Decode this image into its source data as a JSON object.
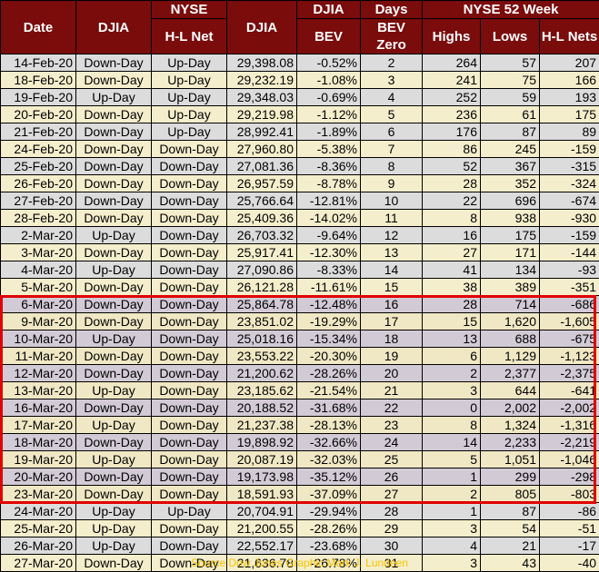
{
  "header": {
    "row1": [
      "Date",
      "DJIA",
      "NYSE",
      "DJIA",
      "DJIA",
      "Days",
      "NYSE 52 Week"
    ],
    "row2": [
      "H-L Net",
      "BEV",
      "BEV Zero",
      "Highs",
      "Lows",
      "H-L Nets"
    ]
  },
  "rows": [
    [
      "14-Feb-20",
      "Down-Day",
      "Up-Day",
      "29,398.08",
      "-0.52%",
      "2",
      "264",
      "57",
      "207"
    ],
    [
      "18-Feb-20",
      "Down-Day",
      "Up-Day",
      "29,232.19",
      "-1.08%",
      "3",
      "241",
      "75",
      "166"
    ],
    [
      "19-Feb-20",
      "Up-Day",
      "Up-Day",
      "29,348.03",
      "-0.69%",
      "4",
      "252",
      "59",
      "193"
    ],
    [
      "20-Feb-20",
      "Down-Day",
      "Up-Day",
      "29,219.98",
      "-1.12%",
      "5",
      "236",
      "61",
      "175"
    ],
    [
      "21-Feb-20",
      "Down-Day",
      "Up-Day",
      "28,992.41",
      "-1.89%",
      "6",
      "176",
      "87",
      "89"
    ],
    [
      "24-Feb-20",
      "Down-Day",
      "Down-Day",
      "27,960.80",
      "-5.38%",
      "7",
      "86",
      "245",
      "-159"
    ],
    [
      "25-Feb-20",
      "Down-Day",
      "Down-Day",
      "27,081.36",
      "-8.36%",
      "8",
      "52",
      "367",
      "-315"
    ],
    [
      "26-Feb-20",
      "Down-Day",
      "Down-Day",
      "26,957.59",
      "-8.78%",
      "9",
      "28",
      "352",
      "-324"
    ],
    [
      "27-Feb-20",
      "Down-Day",
      "Down-Day",
      "25,766.64",
      "-12.81%",
      "10",
      "22",
      "696",
      "-674"
    ],
    [
      "28-Feb-20",
      "Down-Day",
      "Down-Day",
      "25,409.36",
      "-14.02%",
      "11",
      "8",
      "938",
      "-930"
    ],
    [
      "2-Mar-20",
      "Up-Day",
      "Down-Day",
      "26,703.32",
      "-9.64%",
      "12",
      "16",
      "175",
      "-159"
    ],
    [
      "3-Mar-20",
      "Down-Day",
      "Down-Day",
      "25,917.41",
      "-12.30%",
      "13",
      "27",
      "171",
      "-144"
    ],
    [
      "4-Mar-20",
      "Up-Day",
      "Down-Day",
      "27,090.86",
      "-8.33%",
      "14",
      "41",
      "134",
      "-93"
    ],
    [
      "5-Mar-20",
      "Down-Day",
      "Down-Day",
      "26,121.28",
      "-11.61%",
      "15",
      "38",
      "389",
      "-351"
    ],
    [
      "6-Mar-20",
      "Down-Day",
      "Down-Day",
      "25,864.78",
      "-12.48%",
      "16",
      "28",
      "714",
      "-686"
    ],
    [
      "9-Mar-20",
      "Down-Day",
      "Down-Day",
      "23,851.02",
      "-19.29%",
      "17",
      "15",
      "1,620",
      "-1,605"
    ],
    [
      "10-Mar-20",
      "Up-Day",
      "Down-Day",
      "25,018.16",
      "-15.34%",
      "18",
      "13",
      "688",
      "-675"
    ],
    [
      "11-Mar-20",
      "Down-Day",
      "Down-Day",
      "23,553.22",
      "-20.30%",
      "19",
      "6",
      "1,129",
      "-1,123"
    ],
    [
      "12-Mar-20",
      "Down-Day",
      "Down-Day",
      "21,200.62",
      "-28.26%",
      "20",
      "2",
      "2,377",
      "-2,375"
    ],
    [
      "13-Mar-20",
      "Up-Day",
      "Down-Day",
      "23,185.62",
      "-21.54%",
      "21",
      "3",
      "644",
      "-641"
    ],
    [
      "16-Mar-20",
      "Down-Day",
      "Down-Day",
      "20,188.52",
      "-31.68%",
      "22",
      "0",
      "2,002",
      "-2,002"
    ],
    [
      "17-Mar-20",
      "Up-Day",
      "Down-Day",
      "21,237.38",
      "-28.13%",
      "23",
      "8",
      "1,324",
      "-1,316"
    ],
    [
      "18-Mar-20",
      "Down-Day",
      "Down-Day",
      "19,898.92",
      "-32.66%",
      "24",
      "14",
      "2,233",
      "-2,219"
    ],
    [
      "19-Mar-20",
      "Up-Day",
      "Down-Day",
      "20,087.19",
      "-32.03%",
      "25",
      "5",
      "1,051",
      "-1,046"
    ],
    [
      "20-Mar-20",
      "Down-Day",
      "Down-Day",
      "19,173.98",
      "-35.12%",
      "26",
      "1",
      "299",
      "-298"
    ],
    [
      "23-Mar-20",
      "Down-Day",
      "Down-Day",
      "18,591.93",
      "-37.09%",
      "27",
      "2",
      "805",
      "-803"
    ],
    [
      "24-Mar-20",
      "Up-Day",
      "Up-Day",
      "20,704.91",
      "-29.94%",
      "28",
      "1",
      "87",
      "-86"
    ],
    [
      "25-Mar-20",
      "Up-Day",
      "Down-Day",
      "21,200.55",
      "-28.26%",
      "29",
      "3",
      "54",
      "-51"
    ],
    [
      "26-Mar-20",
      "Up-Day",
      "Down-Day",
      "22,552.17",
      "-23.68%",
      "30",
      "4",
      "21",
      "-17"
    ],
    [
      "27-Mar-20",
      "Down-Day",
      "Down-Day",
      "21,636.78",
      "-26.78%",
      "31",
      "3",
      "43",
      "-40"
    ]
  ],
  "highlight": {
    "first_row": 14,
    "last_row": 25,
    "color": "#e00000"
  },
  "colors": {
    "header_bg": "#7a0c0c",
    "row_gray": "#dcdcdc",
    "row_cream": "#f5eecc"
  },
  "footer": "Source Dow Jones   Graphic Mark J. Lundeen"
}
